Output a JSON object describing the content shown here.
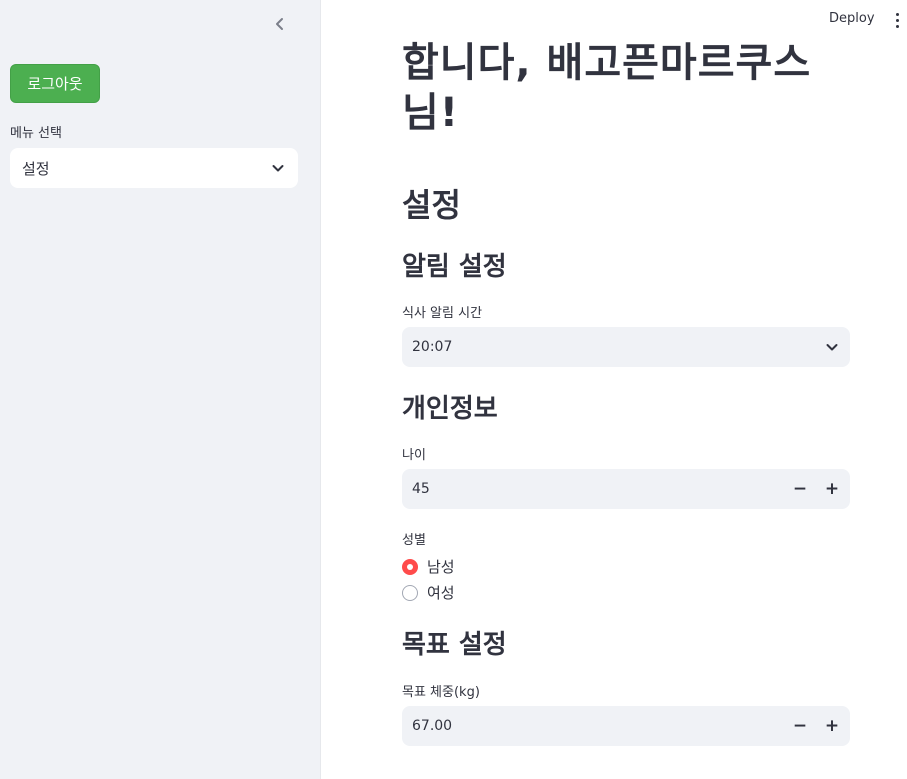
{
  "sidebar": {
    "logout_label": "로그아웃",
    "menu_label": "메뉴 선택",
    "menu_selected": "설정"
  },
  "header": {
    "deploy_label": "Deploy"
  },
  "main": {
    "greeting": "합니다, 배고픈마르쿠스님!",
    "title": "설정",
    "notification": {
      "heading": "알림 설정",
      "meal_time_label": "식사 알림 시간",
      "meal_time_value": "20:07"
    },
    "personal": {
      "heading": "개인정보",
      "age_label": "나이",
      "age_value": "45",
      "gender_label": "성별",
      "gender_options": [
        "남성",
        "여성"
      ],
      "gender_selected": "남성"
    },
    "goal": {
      "heading": "목표 설정",
      "weight_label": "목표 체중(kg)",
      "weight_value": "67.00"
    },
    "stepper_minus": "−",
    "stepper_plus": "+"
  },
  "colors": {
    "primary": "#ff4b4b",
    "logout_button": "#4caf50",
    "sidebar_bg": "#f0f2f6",
    "text": "#31333f"
  }
}
